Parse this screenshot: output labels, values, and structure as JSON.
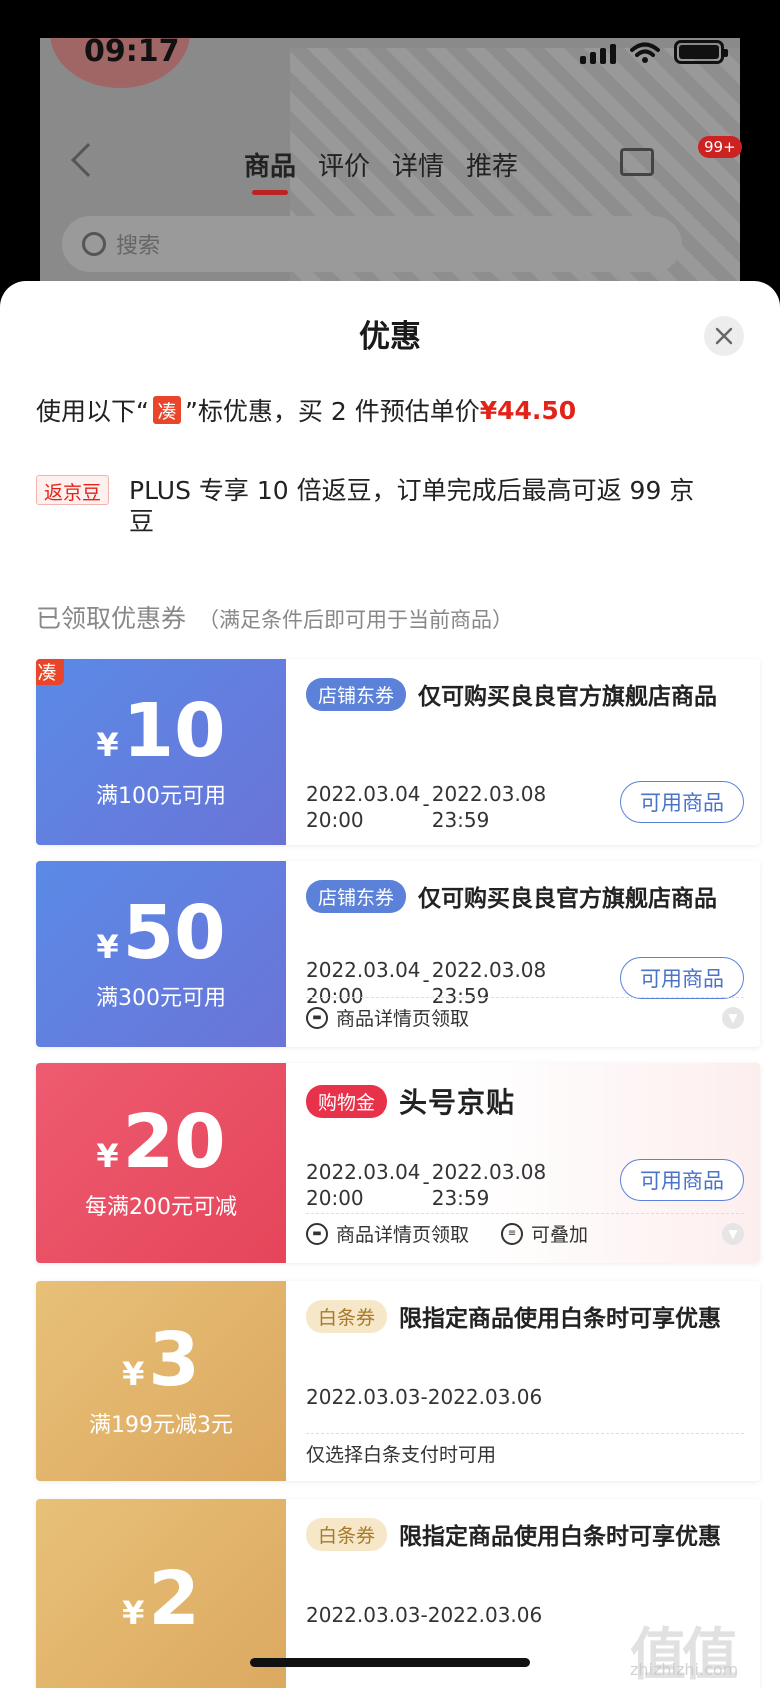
{
  "status": {
    "time": "09:17"
  },
  "background": {
    "tabs": [
      "商品",
      "评价",
      "详情",
      "推荐"
    ],
    "badge": "99+",
    "search_placeholder": "搜索"
  },
  "sheet": {
    "title": "优惠",
    "promo": {
      "prefix": "使用以下“",
      "tag": "凑",
      "suffix": "”标优惠，买 2 件预估单价",
      "price": "¥44.50"
    },
    "bean": {
      "tag": "返京豆",
      "text": "PLUS 专享 10 倍返豆，订单完成后最高可返 99 京豆"
    },
    "section": {
      "title": "已领取优惠券",
      "note": "（满足条件后即可用于当前商品）"
    },
    "coupons": [
      {
        "corner": "凑",
        "yen": "¥",
        "amount": "10",
        "condition": "满100元可用",
        "pill": "店铺东券",
        "title": "仅可购买良良官方旗舰店商品",
        "start": "2022.03.04",
        "start_time": "20:00",
        "end": "2022.03.08",
        "end_time": "23:59",
        "button": "可用商品"
      },
      {
        "yen": "¥",
        "amount": "50",
        "condition": "满300元可用",
        "pill": "店铺东券",
        "title": "仅可购买良良官方旗舰店商品",
        "start": "2022.03.04",
        "start_time": "20:00",
        "end": "2022.03.08",
        "end_time": "23:59",
        "button": "可用商品",
        "foot": "商品详情页领取"
      },
      {
        "yen": "¥",
        "amount": "20",
        "condition": "每满200元可减",
        "pill": "购物金",
        "title": "头号京贴",
        "start": "2022.03.04",
        "start_time": "20:00",
        "end": "2022.03.08",
        "end_time": "23:59",
        "button": "可用商品",
        "foot": "商品详情页领取",
        "foot2": "可叠加"
      },
      {
        "yen": "¥",
        "amount": "3",
        "condition": "满199元减3元",
        "pill": "白条券",
        "title": "限指定商品使用白条时可享优惠",
        "date": "2022.03.03-2022.03.06",
        "foot": "仅选择白条支付时可用"
      },
      {
        "yen": "¥",
        "amount": "2",
        "pill": "白条券",
        "title": "限指定商品使用白条时可享优惠",
        "date": "2022.03.03-2022.03.06"
      }
    ]
  },
  "watermark": {
    "main": "值值值",
    "sub": "zhizhizhi.com"
  },
  "colors": {
    "accent": "#e2231a",
    "blue": "#5b82d8",
    "red": "#e8324a",
    "gold": "#dca860"
  }
}
